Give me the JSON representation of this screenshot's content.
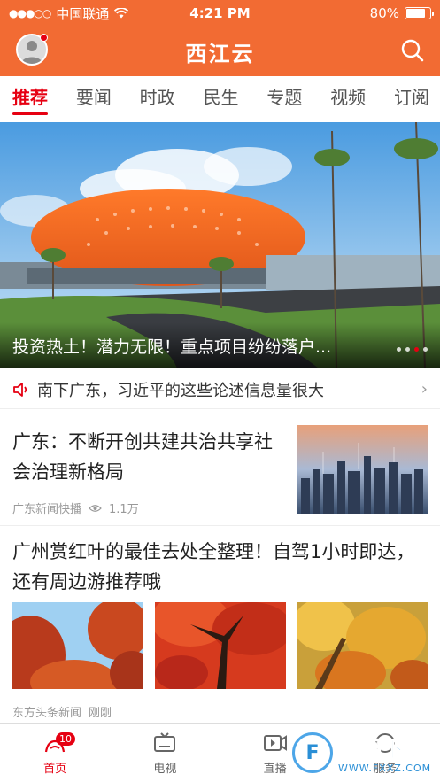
{
  "status_bar": {
    "signal_dots": "●●●○○",
    "carrier": "中国联通",
    "wifi_icon": "wifi-icon",
    "time": "4:21 PM",
    "battery_text": "80%",
    "battery_level": 0.8
  },
  "header": {
    "title": "西江云",
    "avatar_icon": "user-avatar-icon",
    "search_icon": "search-icon",
    "accent_color": "#f26b33"
  },
  "tabs": [
    {
      "label": "推荐",
      "active": true
    },
    {
      "label": "要闻"
    },
    {
      "label": "时政"
    },
    {
      "label": "民生"
    },
    {
      "label": "专题"
    },
    {
      "label": "视频"
    },
    {
      "label": "订阅"
    }
  ],
  "hero": {
    "caption": "投资热土！潜力无限！重点项目纷纷落户...",
    "page_count": 4,
    "active_page": 3
  },
  "ticker": {
    "icon": "speaker-icon",
    "text": "南下广东，习近平的这些论述信息量很大",
    "arrow": "›"
  },
  "articles": [
    {
      "title": "广东：不断开创共建共治共享社会治理新格局",
      "source": "广东新闻快播",
      "views": "1.1万",
      "image": "city-skyline-image"
    },
    {
      "title": "广州赏红叶的最佳去处全整理！自驾1小时即达，还有周边游推荐哦",
      "source": "东方头条新闻",
      "time": "刚刚",
      "images": [
        "red-leaves-sky-image",
        "red-maple-tree-image",
        "yellow-leaves-image"
      ]
    }
  ],
  "bottom_nav": [
    {
      "label": "首页",
      "icon": "home-icon",
      "active": true,
      "badge": "10"
    },
    {
      "label": "电视",
      "icon": "tv-icon"
    },
    {
      "label": "直播",
      "icon": "live-icon"
    },
    {
      "label": "服务",
      "icon": "service-icon"
    }
  ],
  "watermark": {
    "main": "飞翔下载",
    "sub": "WWW.FXXZ.COM",
    "logo_letter": "F"
  }
}
